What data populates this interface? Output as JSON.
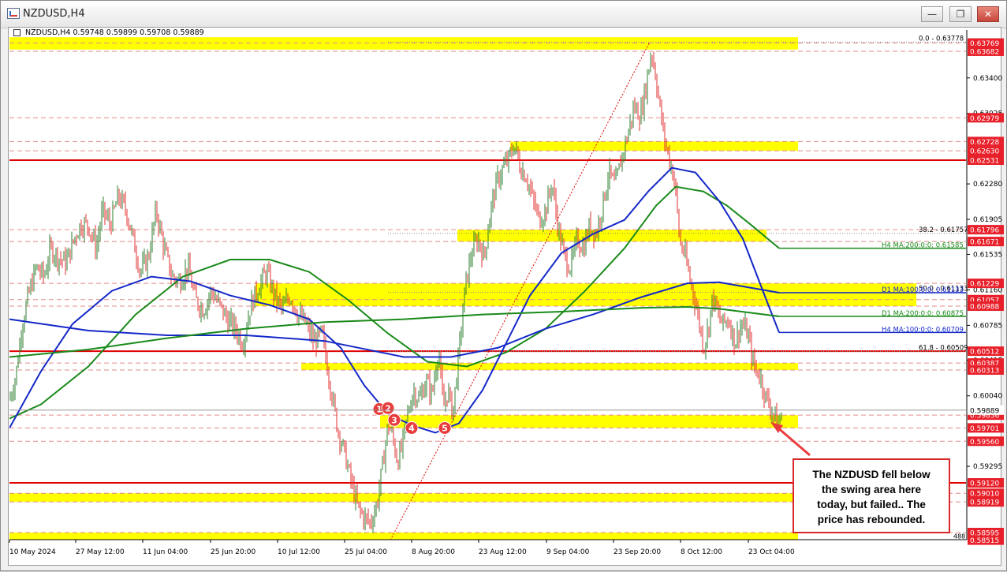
{
  "window": {
    "title": "NZDUSD,H4",
    "minimize_glyph": "—",
    "restore_glyph": "❐",
    "close_glyph": "✕"
  },
  "chart_header": {
    "symbol": "NZDUSD,H4",
    "ohlc": "0.59748 0.59899 0.59708 0.59889"
  },
  "colors": {
    "background": "#ffffff",
    "zone_yellow": "#ffff00",
    "level_red": "#e00000",
    "price_box_red": "#e8202a",
    "ma_blue": "#1428c8",
    "ma_green": "#1a8a1a",
    "ma_dark_green": "#0f6a0f",
    "bull_candle": "#2f7f2f",
    "bear_candle": "#e03030",
    "fib_dotted": "#e00000",
    "grid_dash": "#e58a8a"
  },
  "annotation": {
    "text_lines": [
      "The NZDUSD fell below",
      "the swing area here",
      "today, but failed..  The",
      "price has rebounded."
    ]
  },
  "chart_data": {
    "type": "candlestick",
    "timeframe": "H4",
    "ylim": [
      0.5852,
      0.6384
    ],
    "x_tick_labels": [
      "10 May 2024",
      "27 May 12:00",
      "11 Jun 04:00",
      "25 Jun 20:00",
      "10 Jul 12:00",
      "25 Jul 04:00",
      "8 Aug 20:00",
      "23 Aug 12:00",
      "9 Sep 04:00",
      "23 Sep 20:00",
      "8 Oct 12:00",
      "23 Oct 04:00"
    ],
    "y_tick_labels": [
      "0.63400",
      "0.63025",
      "0.62280",
      "0.61905",
      "0.61535",
      "0.61160",
      "0.60785",
      "0.60415",
      "0.60040",
      "0.59295"
    ],
    "close_path": [
      [
        0,
        0.6
      ],
      [
        8,
        0.6025
      ],
      [
        16,
        0.608
      ],
      [
        24,
        0.611
      ],
      [
        34,
        0.614
      ],
      [
        44,
        0.613
      ],
      [
        52,
        0.616
      ],
      [
        62,
        0.615
      ],
      [
        72,
        0.6145
      ],
      [
        82,
        0.617
      ],
      [
        90,
        0.6185
      ],
      [
        100,
        0.6185
      ],
      [
        110,
        0.616
      ],
      [
        118,
        0.62
      ],
      [
        128,
        0.6185
      ],
      [
        138,
        0.6215
      ],
      [
        148,
        0.62
      ],
      [
        158,
        0.6165
      ],
      [
        166,
        0.6135
      ],
      [
        176,
        0.615
      ],
      [
        186,
        0.62
      ],
      [
        196,
        0.616
      ],
      [
        206,
        0.613
      ],
      [
        216,
        0.6125
      ],
      [
        226,
        0.614
      ],
      [
        236,
        0.6105
      ],
      [
        246,
        0.6095
      ],
      [
        256,
        0.6115
      ],
      [
        266,
        0.61
      ],
      [
        276,
        0.6085
      ],
      [
        286,
        0.6075
      ],
      [
        296,
        0.606
      ],
      [
        306,
        0.61
      ],
      [
        316,
        0.612
      ],
      [
        326,
        0.6135
      ],
      [
        336,
        0.611
      ],
      [
        346,
        0.6095
      ],
      [
        356,
        0.611
      ],
      [
        366,
        0.609
      ],
      [
        376,
        0.608
      ],
      [
        386,
        0.606
      ],
      [
        396,
        0.607
      ],
      [
        406,
        0.602
      ],
      [
        416,
        0.597
      ],
      [
        426,
        0.594
      ],
      [
        434,
        0.591
      ],
      [
        442,
        0.5885
      ],
      [
        450,
        0.5875
      ],
      [
        458,
        0.587
      ],
      [
        466,
        0.589
      ],
      [
        474,
        0.5935
      ],
      [
        480,
        0.5975
      ],
      [
        486,
        0.596
      ],
      [
        492,
        0.5935
      ],
      [
        498,
        0.595
      ],
      [
        504,
        0.598
      ],
      [
        512,
        0.601
      ],
      [
        520,
        0.6
      ],
      [
        528,
        0.602
      ],
      [
        536,
        0.6005
      ],
      [
        544,
        0.6055
      ],
      [
        550,
        0.599
      ],
      [
        556,
        0.601
      ],
      [
        562,
        0.5985
      ],
      [
        570,
        0.605
      ],
      [
        578,
        0.612
      ],
      [
        586,
        0.6155
      ],
      [
        594,
        0.617
      ],
      [
        602,
        0.615
      ],
      [
        610,
        0.62
      ],
      [
        618,
        0.623
      ],
      [
        626,
        0.6245
      ],
      [
        634,
        0.6255
      ],
      [
        640,
        0.627
      ],
      [
        648,
        0.6245
      ],
      [
        656,
        0.6235
      ],
      [
        664,
        0.621
      ],
      [
        672,
        0.619
      ],
      [
        680,
        0.62
      ],
      [
        688,
        0.623
      ],
      [
        696,
        0.618
      ],
      [
        704,
        0.615
      ],
      [
        712,
        0.614
      ],
      [
        720,
        0.617
      ],
      [
        728,
        0.616
      ],
      [
        736,
        0.6185
      ],
      [
        744,
        0.6175
      ],
      [
        752,
        0.6205
      ],
      [
        760,
        0.624
      ],
      [
        768,
        0.6225
      ],
      [
        776,
        0.6255
      ],
      [
        784,
        0.628
      ],
      [
        792,
        0.631
      ],
      [
        800,
        0.63
      ],
      [
        808,
        0.6335
      ],
      [
        814,
        0.637
      ],
      [
        820,
        0.634
      ],
      [
        826,
        0.63
      ],
      [
        832,
        0.627
      ],
      [
        838,
        0.625
      ],
      [
        844,
        0.623
      ],
      [
        850,
        0.6165
      ],
      [
        856,
        0.6155
      ],
      [
        862,
        0.613
      ],
      [
        868,
        0.611
      ],
      [
        874,
        0.6085
      ],
      [
        880,
        0.6055
      ],
      [
        886,
        0.6075
      ],
      [
        892,
        0.611
      ],
      [
        898,
        0.609
      ],
      [
        904,
        0.608
      ],
      [
        912,
        0.6085
      ],
      [
        920,
        0.606
      ],
      [
        928,
        0.608
      ],
      [
        936,
        0.607
      ],
      [
        944,
        0.6035
      ],
      [
        952,
        0.6025
      ],
      [
        958,
        0.6005
      ],
      [
        966,
        0.599
      ],
      [
        972,
        0.598
      ],
      [
        976,
        0.5975
      ],
      [
        980,
        0.5989
      ]
    ],
    "moving_averages": [
      {
        "label": "H4 MA:200:0:0: 0.61585",
        "color": "#1a8a1a",
        "path": [
          [
            0,
            0.598
          ],
          [
            40,
            0.5995
          ],
          [
            100,
            0.6035
          ],
          [
            160,
            0.609
          ],
          [
            220,
            0.613
          ],
          [
            280,
            0.6148
          ],
          [
            330,
            0.6148
          ],
          [
            380,
            0.6135
          ],
          [
            430,
            0.6105
          ],
          [
            480,
            0.607
          ],
          [
            530,
            0.604
          ],
          [
            580,
            0.6035
          ],
          [
            630,
            0.605
          ],
          [
            680,
            0.6075
          ],
          [
            730,
            0.6115
          ],
          [
            780,
            0.616
          ],
          [
            820,
            0.6205
          ],
          [
            845,
            0.6225
          ],
          [
            880,
            0.622
          ],
          [
            910,
            0.6205
          ],
          [
            940,
            0.6185
          ],
          [
            976,
            0.616
          ]
        ]
      },
      {
        "label": "H4 MA:100:0:0: 0.60709",
        "color": "#1428c8",
        "path": [
          [
            0,
            0.597
          ],
          [
            40,
            0.603
          ],
          [
            80,
            0.608
          ],
          [
            130,
            0.6115
          ],
          [
            180,
            0.613
          ],
          [
            230,
            0.6125
          ],
          [
            280,
            0.611
          ],
          [
            330,
            0.61
          ],
          [
            380,
            0.6085
          ],
          [
            420,
            0.6055
          ],
          [
            450,
            0.6015
          ],
          [
            480,
            0.5985
          ],
          [
            510,
            0.5973
          ],
          [
            540,
            0.5965
          ],
          [
            570,
            0.5975
          ],
          [
            600,
            0.601
          ],
          [
            630,
            0.606
          ],
          [
            660,
            0.611
          ],
          [
            700,
            0.6155
          ],
          [
            740,
            0.6175
          ],
          [
            780,
            0.619
          ],
          [
            810,
            0.622
          ],
          [
            840,
            0.6245
          ],
          [
            870,
            0.624
          ],
          [
            900,
            0.621
          ],
          [
            930,
            0.617
          ],
          [
            960,
            0.6105
          ],
          [
            976,
            0.6071
          ]
        ]
      },
      {
        "label": "D1 MA:100:0:0: 0.61133",
        "color": "#1428c8",
        "path": [
          [
            0,
            0.6085
          ],
          [
            100,
            0.6073
          ],
          [
            200,
            0.6068
          ],
          [
            300,
            0.6068
          ],
          [
            400,
            0.6062
          ],
          [
            500,
            0.6045
          ],
          [
            560,
            0.6045
          ],
          [
            620,
            0.6055
          ],
          [
            680,
            0.6075
          ],
          [
            740,
            0.609
          ],
          [
            800,
            0.6108
          ],
          [
            860,
            0.6123
          ],
          [
            900,
            0.6124
          ],
          [
            976,
            0.6113
          ]
        ]
      },
      {
        "label": "D1 MA:200:0:0: 0.60875",
        "color": "#1a8a1a",
        "path": [
          [
            0,
            0.6045
          ],
          [
            100,
            0.6053
          ],
          [
            200,
            0.6065
          ],
          [
            300,
            0.6075
          ],
          [
            400,
            0.6082
          ],
          [
            500,
            0.6085
          ],
          [
            600,
            0.609
          ],
          [
            700,
            0.6093
          ],
          [
            800,
            0.6097
          ],
          [
            860,
            0.6098
          ],
          [
            900,
            0.6096
          ],
          [
            976,
            0.6088
          ]
        ]
      }
    ],
    "horizontal_levels": [
      {
        "price": 0.62531,
        "label": "0.62531",
        "style": "solid"
      },
      {
        "price": 0.60512,
        "label": "0.60512",
        "style": "solid"
      },
      {
        "price": 0.5912,
        "label": "0.59120",
        "style": "solid"
      },
      {
        "price": 0.63769,
        "label": "0.63769",
        "style": "dash"
      },
      {
        "price": 0.63682,
        "label": "0.63682",
        "style": "dash"
      },
      {
        "price": 0.62979,
        "label": "0.62979",
        "style": "dash"
      },
      {
        "price": 0.62728,
        "label": "0.62728",
        "style": "dash"
      },
      {
        "price": 0.6263,
        "label": "0.62630",
        "style": "dash"
      },
      {
        "price": 0.61796,
        "label": "0.61796",
        "style": "dash"
      },
      {
        "price": 0.61671,
        "label": "0.61671",
        "style": "dash"
      },
      {
        "price": 0.61229,
        "label": "0.61229",
        "style": "dash"
      },
      {
        "price": 0.61057,
        "label": "0.61057",
        "style": "dash"
      },
      {
        "price": 0.60988,
        "label": "0.60988",
        "style": "dash"
      },
      {
        "price": 0.60387,
        "label": "0.60387",
        "style": "dash"
      },
      {
        "price": 0.60313,
        "label": "0.60313",
        "style": "dash"
      },
      {
        "price": 0.59836,
        "label": "0.59836",
        "style": "dash"
      },
      {
        "price": 0.59701,
        "label": "0.59701",
        "style": "dash"
      },
      {
        "price": 0.5956,
        "label": "0.59560",
        "style": "dash"
      },
      {
        "price": 0.5901,
        "label": "0.59010",
        "style": "dash"
      },
      {
        "price": 0.58919,
        "label": "0.58919",
        "style": "dash"
      },
      {
        "price": 0.58595,
        "label": "0.58595",
        "style": "dash"
      },
      {
        "price": 0.58515,
        "label": "0.58515",
        "style": "dash"
      }
    ],
    "current_price": {
      "price": 0.59889,
      "label": "0.59889"
    },
    "fibonacci": {
      "levels": [
        {
          "ratio": "0.0",
          "price": 0.63778,
          "label": "0.0 - 0.63778"
        },
        {
          "ratio": "38.2",
          "price": 0.61757,
          "label": "38.2 - 0.61757"
        },
        {
          "ratio": "50.0",
          "price": 0.61133,
          "label": "50.0 - 0.61133"
        },
        {
          "ratio": "61.8",
          "price": 0.60509,
          "label": "61.8 - 0.60509"
        }
      ],
      "low_label": "488"
    },
    "zones": [
      {
        "from": 0.6383,
        "to": 0.637,
        "span": "full"
      },
      {
        "from": 0.62728,
        "to": 0.6263,
        "span": "right_half"
      },
      {
        "from": 0.61796,
        "to": 0.61671,
        "span": "fib_area"
      },
      {
        "from": 0.61229,
        "to": 0.60988,
        "span": "mid"
      },
      {
        "from": 0.60387,
        "to": 0.60313,
        "span": "mid2"
      },
      {
        "from": 0.59836,
        "to": 0.59701,
        "span": "swing"
      },
      {
        "from": 0.5901,
        "to": 0.58919,
        "span": "full"
      },
      {
        "from": 0.58595,
        "to": 0.58515,
        "span": "full"
      }
    ],
    "swing_markers": [
      {
        "label": "1",
        "price": 0.599
      },
      {
        "label": "2",
        "price": 0.5991
      },
      {
        "label": "3",
        "price": 0.5981
      },
      {
        "label": "4",
        "price": 0.597
      },
      {
        "label": "5",
        "price": 0.597
      }
    ]
  }
}
